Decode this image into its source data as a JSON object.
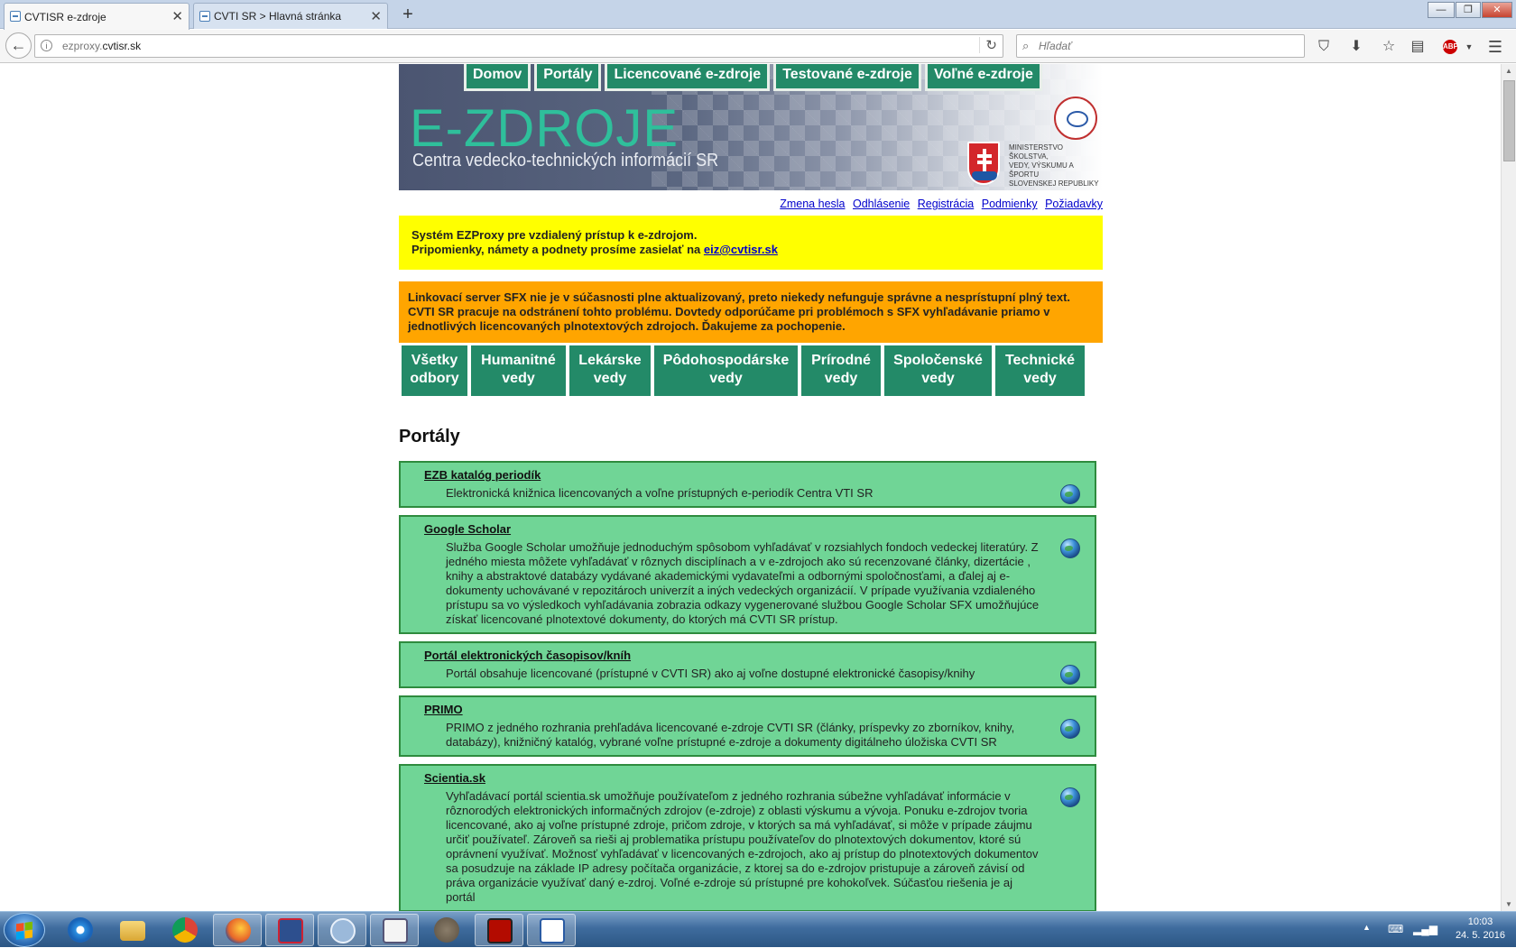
{
  "browser": {
    "tabs": [
      {
        "label": "CVTISR e-zdroje",
        "active": true
      },
      {
        "label": "CVTI SR > Hlavná stránka",
        "active": false
      }
    ],
    "new_tab": "+",
    "url_plain": "ezproxy.",
    "url_domain": "cvtisr.sk",
    "search_placeholder": "Hľadať",
    "abp": "ABP"
  },
  "banner": {
    "title": "E-ZDROJE",
    "subtitle": "Centra vedecko-technických informácií SR",
    "ministry": [
      "Ministerstvo školstva,",
      "vedy, výskumu a športu",
      "Slovenskej republiky"
    ]
  },
  "topnav": [
    "Domov",
    "Portály",
    "Licencované e-zdroje",
    "Testované e-zdroje",
    "Voľné e-zdroje"
  ],
  "toplinks": [
    "Zmena hesla",
    "Odhlásenie",
    "Registrácia",
    "Podmienky",
    "Požiadavky"
  ],
  "notice_yellow": {
    "line1": "Systém EZProxy pre vzdialený prístup k e-zdrojom.",
    "line2": "Pripomienky, námety a podnety prosíme zasielať na",
    "email": "eiz@cvtisr.sk"
  },
  "notice_orange": "Linkovací server SFX nie je v súčasnosti plne aktualizovaný, preto niekedy nefunguje správne a nesprístupní plný text. CVTI SR pracuje na odstránení tohto problému. Dovtedy odporúčame pri problémoch s SFX vyhľadávanie priamo v jednotlivých licencovaných plnotextových zdrojoch. Ďakujeme za pochopenie.",
  "subjects": [
    {
      "line1": "Všetky",
      "line2": "odbory"
    },
    {
      "line1": "Humanitné",
      "line2": "vedy"
    },
    {
      "line1": "Lekárske",
      "line2": "vedy"
    },
    {
      "line1": "Pôdohospodárske",
      "line2": "vedy"
    },
    {
      "line1": "Prírodné",
      "line2": "vedy"
    },
    {
      "line1": "Spoločenské",
      "line2": "vedy"
    },
    {
      "line1": "Technické",
      "line2": "vedy"
    }
  ],
  "portals_heading": "Portály",
  "portals": [
    {
      "title": "EZB katalóg periodík",
      "desc": "Elektronická knižnica licencovaných a voľne prístupných e-periodík Centra VTI SR"
    },
    {
      "title": "Google Scholar",
      "desc": "Služba Google Scholar umožňuje jednoduchým spôsobom vyhľadávať v rozsiahlych fondoch vedeckej literatúry. Z jedného miesta môžete vyhľadávať v rôznych disciplínach a v e-zdrojoch ako sú recenzované články, dizertácie , knihy a abstraktové databázy vydávané akademickými vydavateľmi a odbornými spoločnosťami, a ďalej aj e-dokumenty uchovávané v repozitároch univerzít a iných vedeckých organizácií. V prípade využívania vzdialeného prístupu sa vo výsledkoch vyhľadávania zobrazia odkazy vygenerované službou Google Scholar SFX umožňujúce získať licencované plnotextové dokumenty, do ktorých má CVTI SR prístup."
    },
    {
      "title": "Portál elektronických časopisov/kníh",
      "desc": "Portál obsahuje licencované (prístupné v CVTI SR) ako aj voľne dostupné elektronické časopisy/knihy"
    },
    {
      "title": "PRIMO",
      "desc": "PRIMO z jedného rozhrania prehľadáva licencované e-zdroje CVTI SR (články, príspevky zo zborníkov, knihy, databázy), knižničný katalóg, vybrané voľne prístupné e-zdroje a dokumenty digitálneho úložiska CVTI SR"
    },
    {
      "title": "Scientia.sk",
      "desc": "Vyhľadávací portál scientia.sk umožňuje používateľom z jedného rozhrania súbežne vyhľadávať informácie v rôznorodých elektronických informačných zdrojov (e-zdroje) z oblasti výskumu a vývoja. Ponuku e-zdrojov tvoria licencované, ako aj voľne prístupné zdroje, pričom zdroje, v ktorých sa má vyhľadávať, si môže v prípade záujmu určiť používateľ. Zároveň sa rieši aj problematika prístupu používateľov do plnotextových dokumentov, ktoré sú oprávnení využívať. Možnosť vyhľadávať v licencovaných e-zdrojoch, ako aj prístup do plnotextových dokumentov sa posudzuje na základe IP adresy počítača organizácie, z ktorej sa do e-zdrojov pristupuje a zároveň závisí od práva organizácie využívať daný e-zdroj. Voľné e-zdroje sú prístupné pre kohokoľvek. Súčasťou riešenia je aj portál"
    }
  ],
  "taskbar": {
    "time": "10:03",
    "date": "24. 5. 2016",
    "apps": [
      "internet-explorer",
      "file-explorer",
      "chrome",
      "firefox",
      "save-app",
      "qbittorrent",
      "document-app",
      "gimp",
      "acrobat",
      "writer"
    ]
  }
}
